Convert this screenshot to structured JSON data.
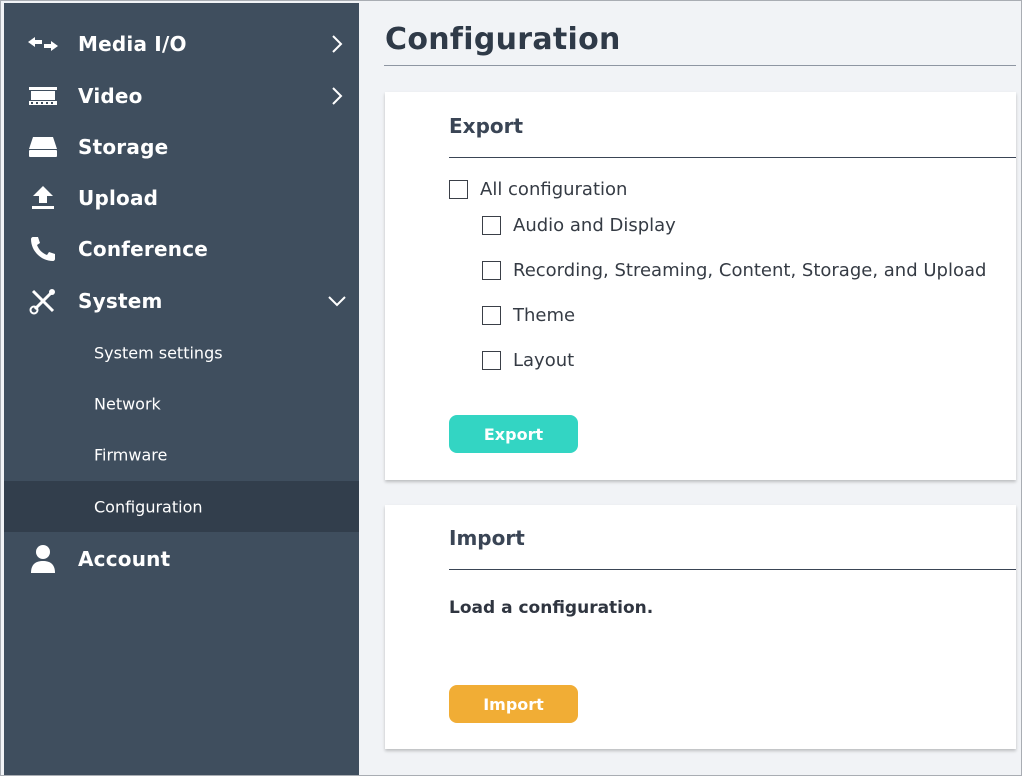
{
  "sidebar": {
    "items": [
      {
        "label": "Media I/O",
        "icon": "arrows-icon"
      },
      {
        "label": "Video",
        "icon": "film-icon"
      },
      {
        "label": "Storage",
        "icon": "drive-icon"
      },
      {
        "label": "Upload",
        "icon": "upload-icon"
      },
      {
        "label": "Conference",
        "icon": "phone-icon"
      },
      {
        "label": "System",
        "icon": "tools-icon"
      },
      {
        "label": "Account",
        "icon": "user-icon"
      }
    ],
    "system_sub": [
      {
        "label": "System settings"
      },
      {
        "label": "Network"
      },
      {
        "label": "Firmware"
      },
      {
        "label": "Configuration",
        "active": true
      }
    ]
  },
  "main": {
    "title": "Configuration",
    "export": {
      "heading": "Export",
      "all_label": "All configuration",
      "options": [
        {
          "label": "Audio and Display"
        },
        {
          "label": "Recording, Streaming, Content, Storage, and Upload"
        },
        {
          "label": "Theme"
        },
        {
          "label": "Layout"
        }
      ],
      "button": "Export"
    },
    "import": {
      "heading": "Import",
      "description": "Load a configuration.",
      "button": "Import"
    }
  },
  "colors": {
    "sidebar_bg": "#3f4e5e",
    "sidebar_active_bg": "#323e4c",
    "export_button": "#33d5c3",
    "import_button": "#f1ad35"
  }
}
